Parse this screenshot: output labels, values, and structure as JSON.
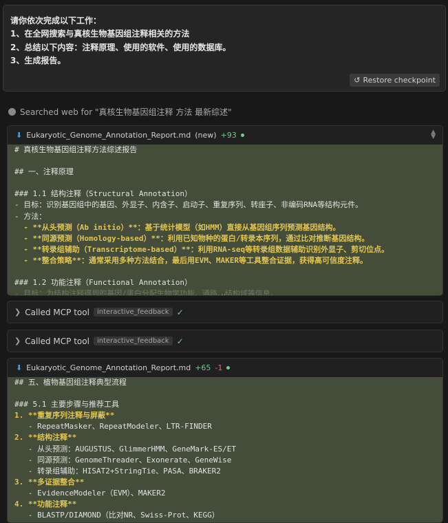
{
  "prompt": {
    "lines": [
      "请你依次完成以下工作：",
      "1、在全网搜索与真核生物基因组注释相关的方法",
      "2、总结以下内容：注释原理、使用的软件、使用的数据库。",
      "3、生成报告。"
    ],
    "restore_label": "Restore checkpoint"
  },
  "search": {
    "text": "Searched web for \"真核生物基因组注释 方法 最新综述\""
  },
  "file1": {
    "name": "Eukaryotic_Genome_Annotation_Report.md",
    "new_tag": "(new)",
    "additions": "+93",
    "lines": [
      "# 真核生物基因组注释方法综述报告",
      "",
      "## 一、注释原理",
      "",
      "### 1.1 结构注释（Structural Annotation）",
      "- 目标：识别基因组中的基因、外显子、内含子、启动子、重复序列、转座子、非编码RNA等结构元件。",
      "- 方法：",
      "  - **从头预测（Ab initio）**：基于统计模型（如HMM）直接从基因组序列预测基因结构。",
      "  - **同源预测（Homology-based）**：利用已知物种的蛋白/转录本序列，通过比对推断基因结构。",
      "  - **转录组辅助（Transcriptome-based）**：利用RNA-seq等转录组数据辅助识别外显子、剪切位点。",
      "  - **整合策略**：通常采用多种方法结合，最后用EVM、MAKER等工具整合证据，获得高可信度注释。",
      "",
      "### 1.2 功能注释（Functional Annotation）",
      "- 目标：为结构注释得到的基因/蛋白分配生物学功能、通路、结构域等信息。"
    ]
  },
  "mcp1": {
    "label": "Called MCP tool",
    "tag": "interactive_feedback"
  },
  "mcp2": {
    "label": "Called MCP tool",
    "tag": "interactive_feedback"
  },
  "file2": {
    "name": "Eukaryotic_Genome_Annotation_Report.md",
    "additions": "+65",
    "deletions": "-1",
    "lines": [
      "## 五、植物基因组注释典型流程",
      "",
      "### 5.1 主要步骤与推荐工具",
      "1. **重复序列注释与屏蔽**",
      "   - RepeatMasker、RepeatModeler、LTR-FINDER",
      "2. **结构注释**",
      "   - 从头预测：AUGUSTUS、GlimmerHMM、GeneMark-ES/ET",
      "   - 同源预测：GenomeThreader、Exonerate、GeneWise",
      "   - 转录组辅助：HISAT2+StringTie、PASA、BRAKER2",
      "3. **多证据整合**",
      "   - EvidenceModeler（EVM）、MAKER2",
      "4. **功能注释**",
      "   - BLASTP/DIAMOND（比对NR、Swiss-Prot、KEGG）"
    ]
  }
}
